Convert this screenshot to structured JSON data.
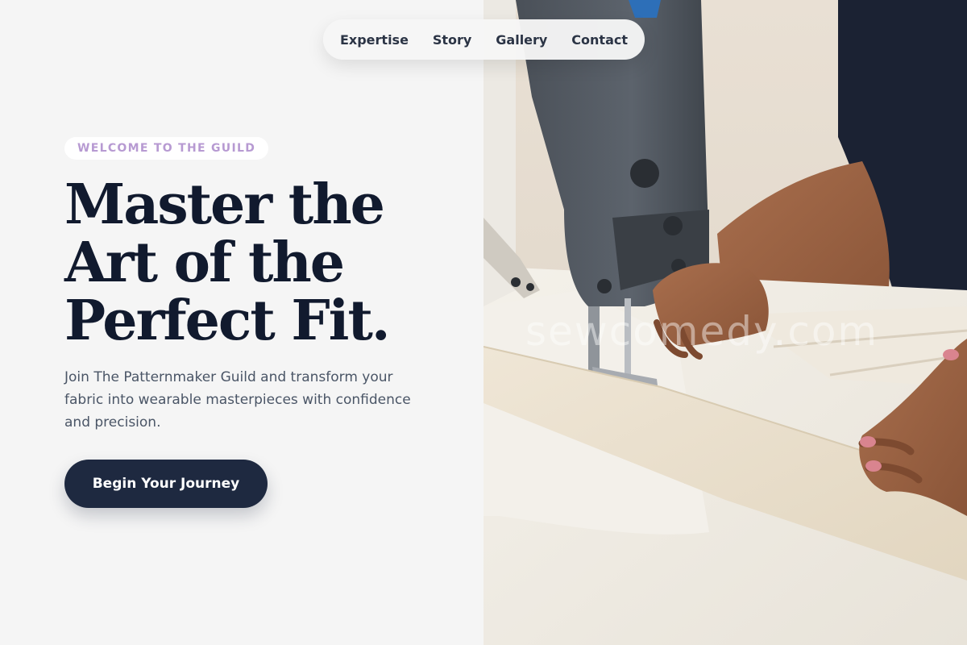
{
  "nav": {
    "items": [
      {
        "label": "Expertise"
      },
      {
        "label": "Story"
      },
      {
        "label": "Gallery"
      },
      {
        "label": "Contact"
      }
    ]
  },
  "hero": {
    "eyebrow": "WELCOME TO THE GUILD",
    "headline_lines": [
      "Master the",
      "Art of the",
      "Perfect Fit."
    ],
    "subtext": "Join The Patternmaker Guild and transform your fabric into wearable masterpieces with confidence and precision.",
    "cta_label": "Begin Your Journey"
  },
  "image": {
    "watermark": "sewcomedy.com",
    "subject": "sewing-machine-photo"
  },
  "colors": {
    "page_bg": "#f5f5f5",
    "heading": "#111a2e",
    "body_text": "#4a5566",
    "eyebrow": "#b79ad2",
    "cta_bg": "#1e2940",
    "cta_text": "#ffffff"
  }
}
